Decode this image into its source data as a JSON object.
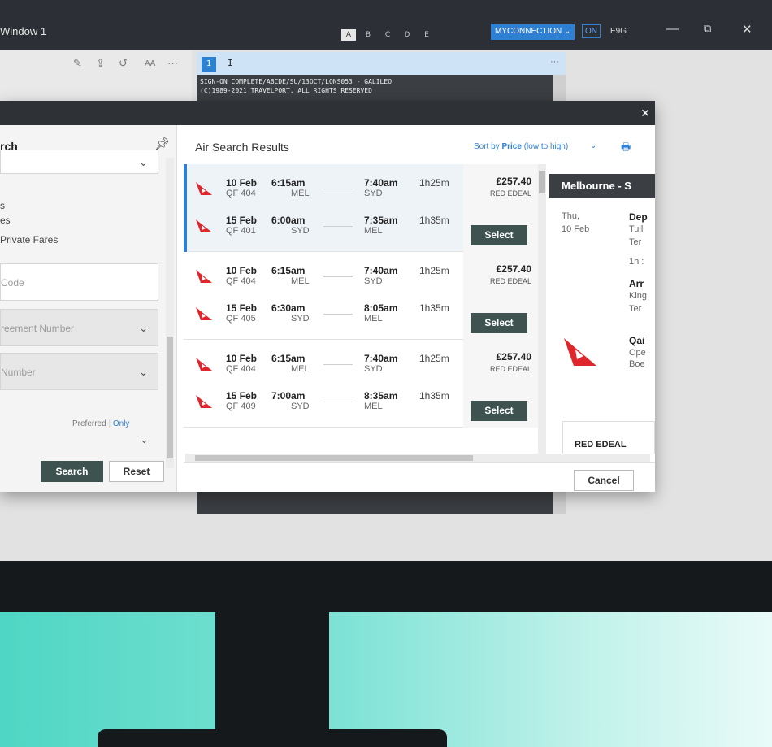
{
  "window": {
    "title": "Window 1",
    "tabs": [
      "A",
      "B",
      "C",
      "D",
      "E"
    ],
    "active_tab": "A",
    "connection_label": "MYCONNECTION",
    "on_label": "ON",
    "code": "E9G"
  },
  "terminal": {
    "number": "1",
    "cursor": "I",
    "lines": [
      "SIGN-ON COMPLETE/ABCDE/SU/13OCT/LONS053 - GALILEO",
      "(C)1989-2021 TRAVELPORT. ALL RIGHTS RESERVED"
    ]
  },
  "search_form": {
    "title": "rch",
    "options": [
      "s",
      "es",
      "Private Fares"
    ],
    "code_placeholder": "Code",
    "agreement_placeholder": "reement Number",
    "number_placeholder": "Number",
    "preferred_label": "Preferred",
    "only_label": "Only",
    "search_button": "Search",
    "reset_button": "Reset"
  },
  "results": {
    "title": "Air Search Results",
    "sort_prefix": "Sort by",
    "sort_key": "Price",
    "sort_suffix": "(low to high)",
    "select_label": "Select",
    "items": [
      {
        "price": "£257.40",
        "fare": "RED EDEAL",
        "outbound": {
          "date": "10 Feb",
          "flight": "QF 404",
          "dep": "6:15am",
          "from": "MEL",
          "arr": "7:40am",
          "to": "SYD",
          "duration": "1h25m"
        },
        "inbound": {
          "date": "15 Feb",
          "flight": "QF 401",
          "dep": "6:00am",
          "from": "SYD",
          "arr": "7:35am",
          "to": "MEL",
          "duration": "1h35m"
        }
      },
      {
        "price": "£257.40",
        "fare": "RED EDEAL",
        "outbound": {
          "date": "10 Feb",
          "flight": "QF 404",
          "dep": "6:15am",
          "from": "MEL",
          "arr": "7:40am",
          "to": "SYD",
          "duration": "1h25m"
        },
        "inbound": {
          "date": "15 Feb",
          "flight": "QF 405",
          "dep": "6:30am",
          "from": "SYD",
          "arr": "8:05am",
          "to": "MEL",
          "duration": "1h35m"
        }
      },
      {
        "price": "£257.40",
        "fare": "RED EDEAL",
        "outbound": {
          "date": "10 Feb",
          "flight": "QF 404",
          "dep": "6:15am",
          "from": "MEL",
          "arr": "7:40am",
          "to": "SYD",
          "duration": "1h25m"
        },
        "inbound": {
          "date": "15 Feb",
          "flight": "QF 409",
          "dep": "7:00am",
          "from": "SYD",
          "arr": "8:35am",
          "to": "MEL",
          "duration": "1h35m"
        }
      }
    ],
    "cancel_button": "Cancel"
  },
  "detail": {
    "route": "Melbourne - S",
    "day": "Thu,",
    "date": "10 Feb",
    "dep_label": "Dep",
    "dep_airport": "Tull",
    "dep_terminal": "Ter",
    "duration": "1h :",
    "arr_label": "Arr",
    "arr_airport": "King",
    "arr_terminal": "Ter",
    "airline": "Qai",
    "operated": "Ope",
    "aircraft": "Boe",
    "fare": "RED EDEAL"
  },
  "colors": {
    "accent": "#2f7fd2",
    "button_dark": "#3e5350",
    "qantas_red": "#e0262d"
  }
}
